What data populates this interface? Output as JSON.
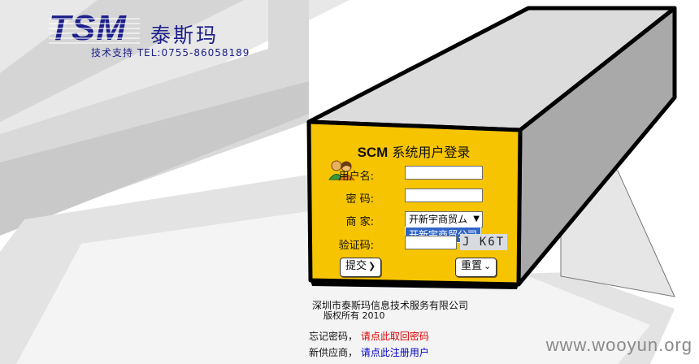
{
  "logo": {
    "brand": "TSM",
    "brand_cn": "泰斯玛",
    "support": "技术支持 TEL:0755-86058189"
  },
  "login": {
    "title_bold": "SCM",
    "title_rest": " 系统用户登录",
    "username_label": "用户名:",
    "username_value": "",
    "password_label": "密  码:",
    "password_value": "",
    "merchant_label": "商  家:",
    "merchant_selected": "开新宇商贸ム",
    "merchant_option": "开新宇商贸公司",
    "captcha_label": "验证码:",
    "captcha_value": "",
    "captcha_image_text": "J K6T",
    "submit_label": "提交",
    "reset_label": "重置"
  },
  "footer": {
    "company": "深圳市泰斯玛信息技术服务有限公司",
    "copyright": "版权所有  2010",
    "forgot_label": "忘记密码，",
    "forgot_link": "请点此取回密码",
    "new_supplier_label": "新供应商，",
    "register_link": "请点此注册用户"
  },
  "watermark": "www.wooyun.org",
  "colors": {
    "panel_yellow": "#f6c400",
    "brand_blue": "#1c1f8a",
    "link_red": "#e00000",
    "link_blue": "#0000cc",
    "dropdown_highlight": "#3166c9"
  },
  "icons": [
    "users-icon",
    "chevron-down-icon",
    "arrow-right-icon"
  ]
}
